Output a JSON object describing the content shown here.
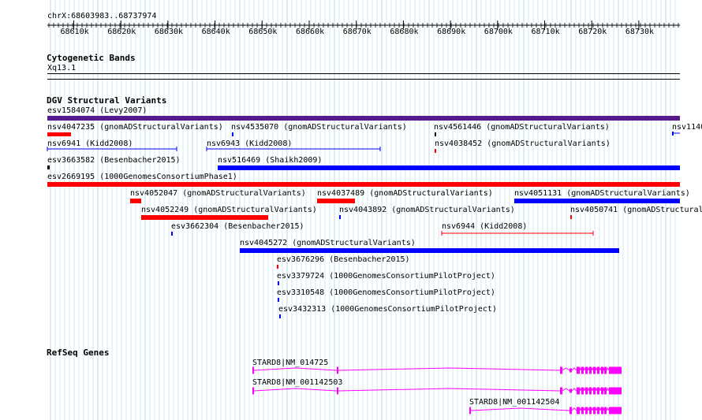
{
  "colors": {
    "grid": "#b3dde6",
    "red": "#ff0000",
    "blue": "#0000ff",
    "purple": "#551a8b",
    "black": "#000000",
    "magenta": "#ff00ff"
  },
  "ruler": {
    "label": "chrX:68603983..68737974",
    "ticks": [
      "68610k",
      "68620k",
      "68630k",
      "68640k",
      "68650k",
      "68660k",
      "68670k",
      "68680k",
      "68690k",
      "68700k",
      "68710k",
      "68720k",
      "68730k"
    ]
  },
  "cytoband": {
    "title": "Cytogenetic Bands",
    "band": "Xq13.1"
  },
  "dgv": {
    "title": "DGV Structural Variants",
    "features": [
      {
        "name": "esv1584074 (Levy2007)",
        "color": "purple",
        "kind": "bar"
      },
      {
        "name": "nsv4047235 (gnomADStructuralVariants)",
        "color": "red",
        "kind": "bar"
      },
      {
        "name": "nsv4535070 (gnomADStructuralVariants)",
        "color": "blue",
        "kind": "tick"
      },
      {
        "name": "nsv4561446 (gnomADStructuralVariants)",
        "color": "black",
        "kind": "tick"
      },
      {
        "name": "nsv1140",
        "color": "blue",
        "kind": "arrow"
      },
      {
        "name": "nsv6941 (Kidd2008)",
        "color": "blue",
        "kind": "range"
      },
      {
        "name": "nsv6943 (Kidd2008)",
        "color": "blue",
        "kind": "range"
      },
      {
        "name": "nsv4038452 (gnomADStructuralVariants)",
        "color": "red",
        "kind": "tick"
      },
      {
        "name": "esv3663582 (Besenbacher2015)",
        "color": "black",
        "kind": "tick"
      },
      {
        "name": "nsv516469 (Shaikh2009)",
        "color": "blue",
        "kind": "bar"
      },
      {
        "name": "esv2669195 (1000GenomesConsortiumPhase1)",
        "color": "red",
        "kind": "bar"
      },
      {
        "name": "nsv4052047 (gnomADStructuralVariants)",
        "color": "red",
        "kind": "bar"
      },
      {
        "name": "nsv4037489 (gnomADStructuralVariants)",
        "color": "red",
        "kind": "bar"
      },
      {
        "name": "nsv4051131 (gnomADStructuralVariants)",
        "color": "blue",
        "kind": "bar"
      },
      {
        "name": "nsv4052249 (gnomADStructuralVariants)",
        "color": "red",
        "kind": "bar"
      },
      {
        "name": "nsv4043892 (gnomADStructuralVariants)",
        "color": "blue",
        "kind": "tick"
      },
      {
        "name": "nsv4050741 (gnomADStructural",
        "color": "red",
        "kind": "tick"
      },
      {
        "name": "esv3662304 (Besenbacher2015)",
        "color": "blue",
        "kind": "tick"
      },
      {
        "name": "nsv6944 (Kidd2008)",
        "color": "red",
        "kind": "range"
      },
      {
        "name": "nsv4045272 (gnomADStructuralVariants)",
        "color": "blue",
        "kind": "bar"
      },
      {
        "name": "esv3676296 (Besenbacher2015)",
        "color": "red",
        "kind": "tick"
      },
      {
        "name": "esv3379724 (1000GenomesConsortiumPilotProject)",
        "color": "blue",
        "kind": "tick"
      },
      {
        "name": "esv3310548 (1000GenomesConsortiumPilotProject)",
        "color": "blue",
        "kind": "tick"
      },
      {
        "name": "esv3432313 (1000GenomesConsortiumPilotProject)",
        "color": "blue",
        "kind": "tick"
      }
    ]
  },
  "refseq": {
    "title": "RefSeq Genes",
    "genes": [
      {
        "name": "STARD8|NM_014725"
      },
      {
        "name": "STARD8|NM_001142503"
      },
      {
        "name": "STARD8|NM_001142504"
      }
    ]
  }
}
